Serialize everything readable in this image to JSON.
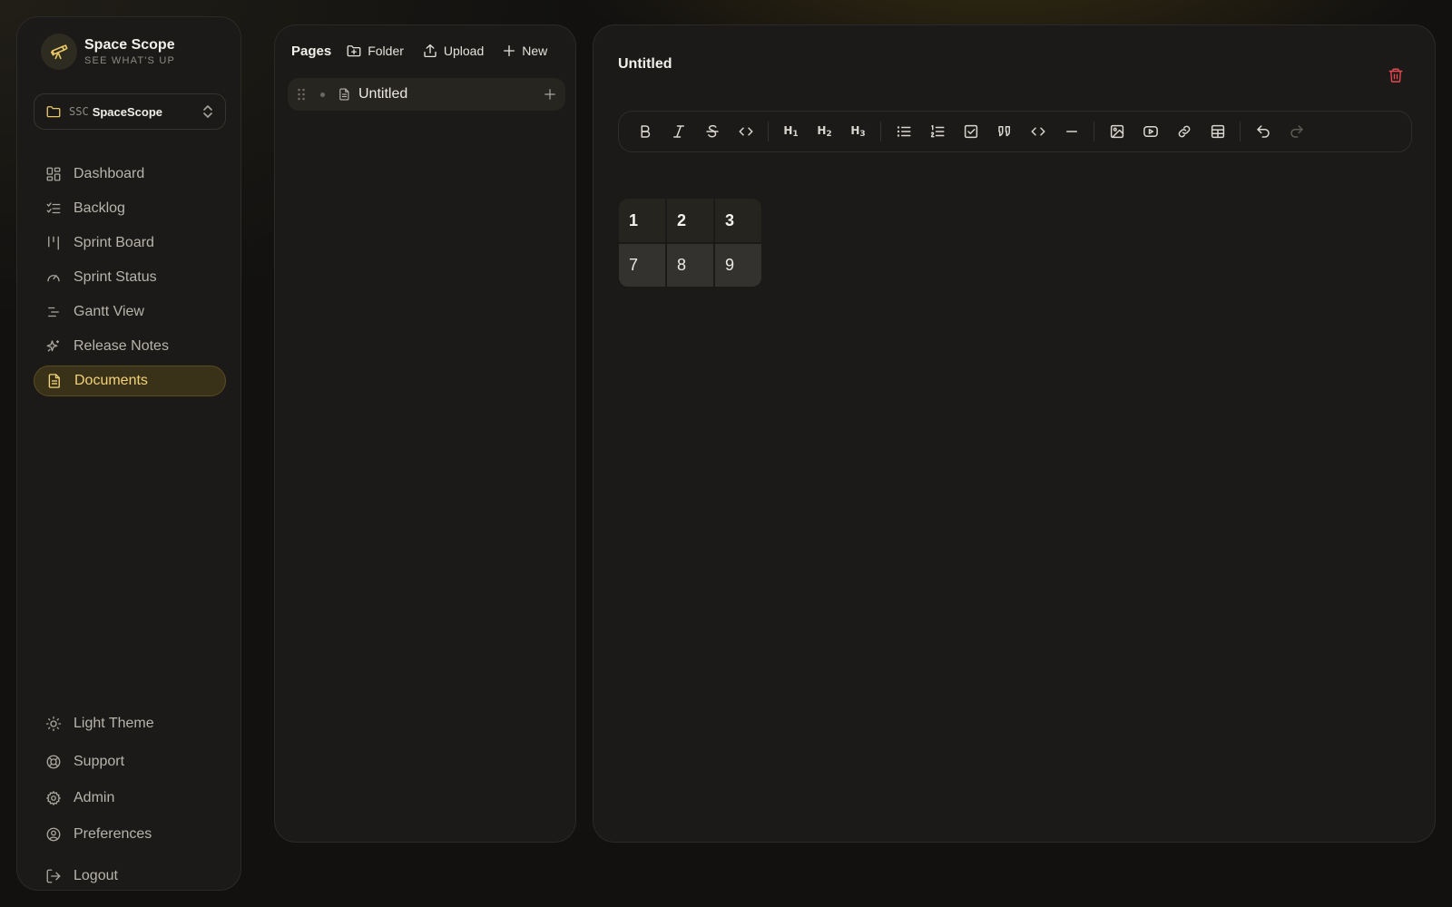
{
  "brand": {
    "name": "Space Scope",
    "tagline": "SEE WHAT'S UP",
    "icon": "telescope-icon"
  },
  "workspace": {
    "code": "SSC",
    "name": "SpaceScope"
  },
  "nav": {
    "main": [
      {
        "label": "Dashboard",
        "icon": "dashboard-icon"
      },
      {
        "label": "Backlog",
        "icon": "list-checks-icon"
      },
      {
        "label": "Sprint Board",
        "icon": "kanban-icon"
      },
      {
        "label": "Sprint Status",
        "icon": "gauge-icon"
      },
      {
        "label": "Gantt View",
        "icon": "gantt-icon"
      },
      {
        "label": "Release Notes",
        "icon": "sparkles-icon"
      },
      {
        "label": "Documents",
        "icon": "file-text-icon",
        "active": true
      }
    ],
    "bottom": [
      {
        "label": "Light Theme",
        "icon": "sun-icon"
      },
      {
        "label": "Support",
        "icon": "life-buoy-icon"
      },
      {
        "label": "Admin",
        "icon": "gear-icon"
      },
      {
        "label": "Preferences",
        "icon": "user-circle-icon"
      },
      {
        "label": "Logout",
        "icon": "logout-icon"
      }
    ]
  },
  "pages": {
    "title": "Pages",
    "folder_label": "Folder",
    "upload_label": "Upload",
    "new_label": "New",
    "items": [
      {
        "name": "Untitled"
      }
    ]
  },
  "editor": {
    "title": "Untitled",
    "table": {
      "header": [
        "1",
        "2",
        "3"
      ],
      "rows": [
        [
          "7",
          "8",
          "9"
        ]
      ]
    }
  },
  "colors": {
    "accent": "#f2d27a",
    "active_bg": "#3a3218",
    "danger": "#e5484d",
    "panel": "#1b1a18"
  }
}
